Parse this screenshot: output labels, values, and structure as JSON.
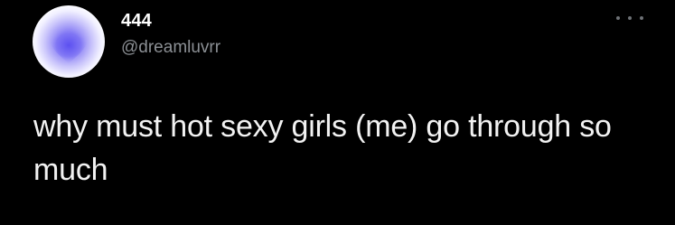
{
  "tweet": {
    "author": {
      "display_name": "444",
      "handle": "@dreamluvrr",
      "avatar": "purple-heart-gradient"
    },
    "text": "why must hot sexy girls (me) go through so much",
    "more_icon": "more-options-icon"
  },
  "colors": {
    "background": "#000000",
    "name": "#ffffff",
    "handle": "#8b8f94",
    "text": "#f2f2f2",
    "avatar_accent": "#6f63f3"
  }
}
